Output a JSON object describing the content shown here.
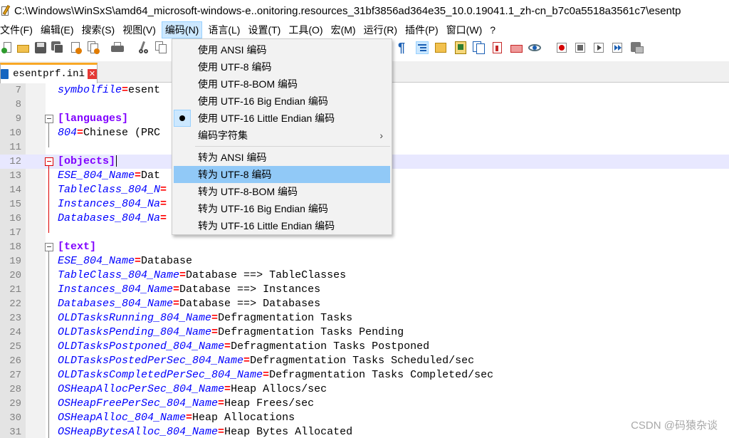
{
  "window": {
    "title": "C:\\Windows\\WinSxS\\amd64_microsoft-windows-e..onitoring.resources_31bf3856ad364e35_10.0.19041.1_zh-cn_b7c0a5518a3561c7\\esentp"
  },
  "menubar": {
    "items": [
      "文件(F)",
      "编辑(E)",
      "搜索(S)",
      "视图(V)",
      "编码(N)",
      "语言(L)",
      "设置(T)",
      "工具(O)",
      "宏(M)",
      "运行(R)",
      "插件(P)",
      "窗口(W)",
      "?"
    ],
    "active_index": 4
  },
  "tab": {
    "label": "esentprf.ini",
    "close": "✕"
  },
  "encoding_menu": {
    "items": [
      {
        "label": "使用 ANSI 编码"
      },
      {
        "label": "使用 UTF-8 编码"
      },
      {
        "label": "使用 UTF-8-BOM 编码"
      },
      {
        "label": "使用 UTF-16 Big Endian 编码"
      },
      {
        "label": "使用 UTF-16 Little Endian 编码",
        "checked": true
      },
      {
        "label": "编码字符集",
        "submenu": true
      },
      {
        "label": "转为 ANSI 编码"
      },
      {
        "label": "转为 UTF-8 编码",
        "hover": true
      },
      {
        "label": "转为 UTF-8-BOM 编码"
      },
      {
        "label": "转为 UTF-16 Big Endian 编码"
      },
      {
        "label": "转为 UTF-16 Little Endian 编码"
      }
    ],
    "submenu_arrow": "›"
  },
  "editor": {
    "lines": [
      {
        "n": "7",
        "key": "symbolfile",
        "val": "esent"
      },
      {
        "n": "8"
      },
      {
        "n": "9",
        "section": "[languages]",
        "fold": true
      },
      {
        "n": "10",
        "key": "804",
        "val": "Chinese (PRC"
      },
      {
        "n": "11"
      },
      {
        "n": "12",
        "section": "[objects]",
        "fold": true,
        "active": true,
        "caret": true
      },
      {
        "n": "13",
        "key": "ESE_804_Name",
        "val": "Dat"
      },
      {
        "n": "14",
        "key": "TableClass_804_N",
        "val": ""
      },
      {
        "n": "15",
        "key": "Instances_804_Na",
        "val": ""
      },
      {
        "n": "16",
        "key": "Databases_804_Na",
        "val": ""
      },
      {
        "n": "17"
      },
      {
        "n": "18",
        "section": "[text]",
        "fold": true
      },
      {
        "n": "19",
        "key": "ESE_804_Name",
        "val": "Database"
      },
      {
        "n": "20",
        "key": "TableClass_804_Name",
        "val": "Database ==> TableClasses"
      },
      {
        "n": "21",
        "key": "Instances_804_Name",
        "val": "Database ==> Instances"
      },
      {
        "n": "22",
        "key": "Databases_804_Name",
        "val": "Database ==> Databases"
      },
      {
        "n": "23",
        "key": "OLDTasksRunning_804_Name",
        "val": "Defragmentation Tasks"
      },
      {
        "n": "24",
        "key": "OLDTasksPending_804_Name",
        "val": "Defragmentation Tasks Pending"
      },
      {
        "n": "25",
        "key": "OLDTasksPostponed_804_Name",
        "val": "Defragmentation Tasks Postponed"
      },
      {
        "n": "26",
        "key": "OLDTasksPostedPerSec_804_Name",
        "val": "Defragmentation Tasks Scheduled/sec"
      },
      {
        "n": "27",
        "key": "OLDTasksCompletedPerSec_804_Name",
        "val": "Defragmentation Tasks Completed/sec"
      },
      {
        "n": "28",
        "key": "OSHeapAllocPerSec_804_Name",
        "val": "Heap Allocs/sec"
      },
      {
        "n": "29",
        "key": "OSHeapFreePerSec_804_Name",
        "val": "Heap Frees/sec"
      },
      {
        "n": "30",
        "key": "OSHeapAlloc_804_Name",
        "val": "Heap Allocations"
      },
      {
        "n": "31",
        "key": "OSHeapBytesAlloc_804_Name",
        "val": "Heap Bytes Allocated"
      }
    ],
    "eq": "="
  },
  "watermark": "CSDN @码猿杂谈",
  "colors": {
    "key": "#0000ff",
    "section": "#8000ff",
    "equals": "#ff0000",
    "menu_hover": "#91c9f7",
    "active_line": "#e8e8ff"
  }
}
